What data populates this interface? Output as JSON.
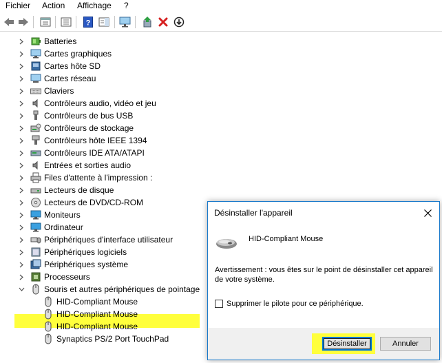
{
  "menubar": {
    "items": [
      "Fichier",
      "Action",
      "Affichage",
      "?"
    ]
  },
  "toolbar": {
    "buttons": [
      "back-arrow-icon",
      "forward-arrow-icon",
      "properties-icon",
      "console-tree-icon",
      "help-icon",
      "action-pane-icon",
      "monitor-scan-icon",
      "update-driver-icon",
      "uninstall-x-icon",
      "download-circle-icon"
    ]
  },
  "tree": {
    "items": [
      {
        "label": "Batteries",
        "icon": "battery-icon",
        "expanded": false
      },
      {
        "label": "Cartes graphiques",
        "icon": "display-adapter-icon",
        "expanded": false
      },
      {
        "label": "Cartes hôte SD",
        "icon": "sd-host-icon",
        "expanded": false
      },
      {
        "label": "Cartes réseau",
        "icon": "network-adapter-icon",
        "expanded": false
      },
      {
        "label": "Claviers",
        "icon": "keyboard-icon",
        "expanded": false
      },
      {
        "label": "Contrôleurs audio, vidéo et jeu",
        "icon": "speaker-icon",
        "expanded": false
      },
      {
        "label": "Contrôleurs de bus USB",
        "icon": "usb-icon",
        "expanded": false
      },
      {
        "label": "Contrôleurs de stockage",
        "icon": "storage-controller-icon",
        "expanded": false
      },
      {
        "label": "Contrôleurs hôte IEEE 1394",
        "icon": "ieee1394-icon",
        "expanded": false
      },
      {
        "label": "Contrôleurs IDE ATA/ATAPI",
        "icon": "ide-icon",
        "expanded": false
      },
      {
        "label": "Entrées et sorties audio",
        "icon": "audio-io-icon",
        "expanded": false
      },
      {
        "label": "Files d'attente à l'impression :",
        "icon": "print-queue-icon",
        "expanded": false
      },
      {
        "label": "Lecteurs de disque",
        "icon": "disk-drive-icon",
        "expanded": false
      },
      {
        "label": "Lecteurs de DVD/CD-ROM",
        "icon": "dvd-icon",
        "expanded": false
      },
      {
        "label": "Moniteurs",
        "icon": "monitor-icon",
        "expanded": false
      },
      {
        "label": "Ordinateur",
        "icon": "computer-icon",
        "expanded": false
      },
      {
        "label": "Périphériques d'interface utilisateur",
        "icon": "hid-icon",
        "expanded": false
      },
      {
        "label": "Périphériques logiciels",
        "icon": "software-device-icon",
        "expanded": false
      },
      {
        "label": "Périphériques système",
        "icon": "system-device-icon",
        "expanded": false
      },
      {
        "label": "Processeurs",
        "icon": "processor-icon",
        "expanded": false
      },
      {
        "label": "Souris et autres périphériques de pointage",
        "icon": "mouse-icon",
        "expanded": true,
        "selected": true
      }
    ],
    "children": [
      {
        "label": "HID-Compliant Mouse",
        "icon": "mouse-icon"
      },
      {
        "label": "HID-Compliant Mouse",
        "icon": "mouse-icon"
      },
      {
        "label": "HID-Compliant Mouse",
        "icon": "mouse-icon"
      },
      {
        "label": "Synaptics PS/2 Port TouchPad",
        "icon": "mouse-icon"
      }
    ]
  },
  "dialog": {
    "title": "Désinstaller l'appareil",
    "device_name": "HID-Compliant Mouse",
    "warning": "Avertissement : vous êtes sur le point de désinstaller cet appareil de votre système.",
    "checkbox_label": "Supprimer le pilote pour ce périphérique.",
    "checkbox_checked": false,
    "uninstall_label": "Désinstaller",
    "cancel_label": "Annuler"
  },
  "colors": {
    "highlight": "#ffff3c",
    "dialog_border": "#1979ca",
    "focus_blue": "#0078d7"
  }
}
